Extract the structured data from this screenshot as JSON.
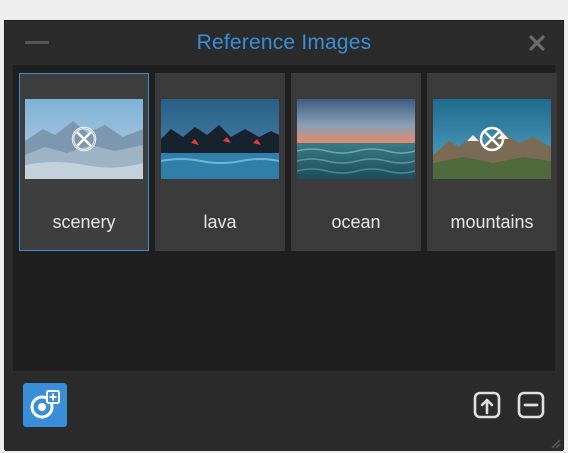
{
  "panel": {
    "title": "Reference Images",
    "accent_color": "#3a8ed8"
  },
  "images": [
    {
      "label": "scenery",
      "selected": true,
      "unlinked": true,
      "icon": "unlinked-icon"
    },
    {
      "label": "lava",
      "selected": false,
      "unlinked": false
    },
    {
      "label": "ocean",
      "selected": false,
      "unlinked": false
    },
    {
      "label": "mountains",
      "selected": false,
      "unlinked": true,
      "icon": "unlinked-icon"
    }
  ],
  "footer": {
    "add_icon": "add-reference-icon",
    "import_icon": "import-icon",
    "remove_icon": "remove-icon"
  }
}
